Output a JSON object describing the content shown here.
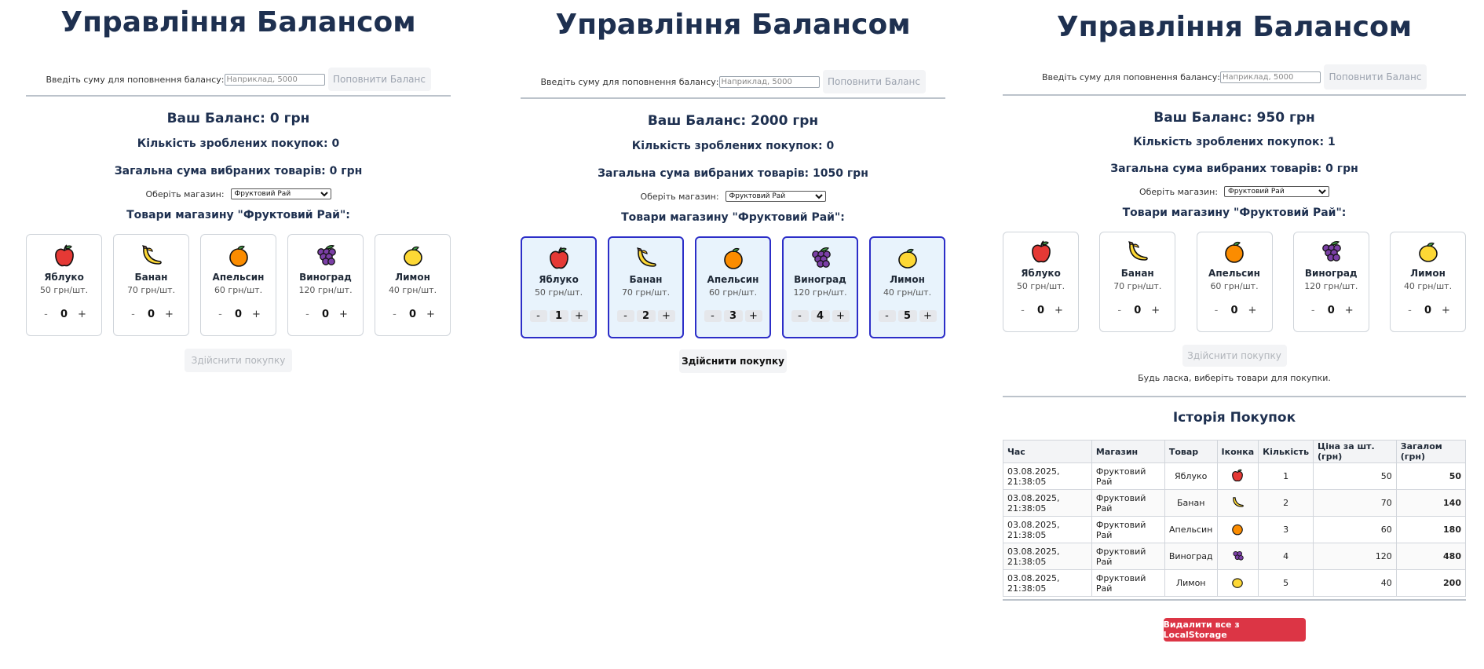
{
  "screens": [
    {
      "title": "Управління Балансом",
      "deposit": {
        "label": "Введіть суму для поповнення балансу:",
        "placeholder": "Наприклад, 5000",
        "button": "Поповнити Баланс"
      },
      "balance": "Ваш Баланс: 0 грн",
      "purchases_count": "Кількість зроблених покупок: 0",
      "selected_total": "Загальна сума вибраних товарів: 0 грн",
      "shop_label": "Оберіть магазин:",
      "shop_selected": "Фруктовий Рай",
      "goods_heading": "Товари магазину \"Фруктовий Рай\":",
      "products": [
        {
          "icon": "apple-icon",
          "name": "Яблуко",
          "price": "50 грн/шт.",
          "qty": "0"
        },
        {
          "icon": "banana-icon",
          "name": "Банан",
          "price": "70 грн/шт.",
          "qty": "0"
        },
        {
          "icon": "orange-icon",
          "name": "Апельсин",
          "price": "60 грн/шт.",
          "qty": "0"
        },
        {
          "icon": "grapes-icon",
          "name": "Виноград",
          "price": "120 грн/шт.",
          "qty": "0"
        },
        {
          "icon": "lemon-icon",
          "name": "Лимон",
          "price": "40 грн/шт.",
          "qty": "0"
        }
      ],
      "buy_button": "Здійснити покупку"
    },
    {
      "title": "Управління Балансом",
      "deposit": {
        "label": "Введіть суму для поповнення балансу:",
        "placeholder": "Наприклад, 5000",
        "button": "Поповнити Баланс"
      },
      "balance": "Ваш Баланс: 2000 грн",
      "purchases_count": "Кількість зроблених покупок: 0",
      "selected_total": "Загальна сума вибраних товарів: 1050 грн",
      "shop_label": "Оберіть магазин:",
      "shop_selected": "Фруктовий Рай",
      "goods_heading": "Товари магазину \"Фруктовий Рай\":",
      "products": [
        {
          "icon": "apple-icon",
          "name": "Яблуко",
          "price": "50 грн/шт.",
          "qty": "1"
        },
        {
          "icon": "banana-icon",
          "name": "Банан",
          "price": "70 грн/шт.",
          "qty": "2"
        },
        {
          "icon": "orange-icon",
          "name": "Апельсин",
          "price": "60 грн/шт.",
          "qty": "3"
        },
        {
          "icon": "grapes-icon",
          "name": "Виноград",
          "price": "120 грн/шт.",
          "qty": "4"
        },
        {
          "icon": "lemon-icon",
          "name": "Лимон",
          "price": "40 грн/шт.",
          "qty": "5"
        }
      ],
      "buy_button": "Здійснити покупку"
    },
    {
      "title": "Управління Балансом",
      "deposit": {
        "label": "Введіть суму для поповнення балансу:",
        "placeholder": "Наприклад, 5000",
        "button": "Поповнити Баланс"
      },
      "balance": "Ваш Баланс: 950 грн",
      "purchases_count": "Кількість зроблених покупок: 1",
      "selected_total": "Загальна сума вибраних товарів: 0 грн",
      "shop_label": "Оберіть магазин:",
      "shop_selected": "Фруктовий Рай",
      "goods_heading": "Товари магазину \"Фруктовий Рай\":",
      "products": [
        {
          "icon": "apple-icon",
          "name": "Яблуко",
          "price": "50 грн/шт.",
          "qty": "0"
        },
        {
          "icon": "banana-icon",
          "name": "Банан",
          "price": "70 грн/шт.",
          "qty": "0"
        },
        {
          "icon": "orange-icon",
          "name": "Апельсин",
          "price": "60 грн/шт.",
          "qty": "0"
        },
        {
          "icon": "grapes-icon",
          "name": "Виноград",
          "price": "120 грн/шт.",
          "qty": "0"
        },
        {
          "icon": "lemon-icon",
          "name": "Лимон",
          "price": "40 грн/шт.",
          "qty": "0"
        }
      ],
      "buy_button": "Здійснити покупку",
      "hint": "Будь ласка, виберіть товари для покупки.",
      "history": {
        "title": "Історія Покупок",
        "headers": [
          "Час",
          "Магазин",
          "Товар",
          "Іконка",
          "Кількість",
          "Ціна за шт. (грн)",
          "Загалом (грн)"
        ],
        "rows": [
          {
            "time": "03.08.2025, 21:38:05",
            "shop": "Фруктовий Рай",
            "item": "Яблуко",
            "icon": "apple-icon",
            "qty": "1",
            "price": "50",
            "total": "50"
          },
          {
            "time": "03.08.2025, 21:38:05",
            "shop": "Фруктовий Рай",
            "item": "Банан",
            "icon": "banana-icon",
            "qty": "2",
            "price": "70",
            "total": "140"
          },
          {
            "time": "03.08.2025, 21:38:05",
            "shop": "Фруктовий Рай",
            "item": "Апельсин",
            "icon": "orange-icon",
            "qty": "3",
            "price": "60",
            "total": "180"
          },
          {
            "time": "03.08.2025, 21:38:05",
            "shop": "Фруктовий Рай",
            "item": "Виноград",
            "icon": "grapes-icon",
            "qty": "4",
            "price": "120",
            "total": "480"
          },
          {
            "time": "03.08.2025, 21:38:05",
            "shop": "Фруктовий Рай",
            "item": "Лимон",
            "icon": "lemon-icon",
            "qty": "5",
            "price": "40",
            "total": "200"
          }
        ]
      },
      "clear_button": "Видалити все з LocalStorage"
    }
  ],
  "qty_minus": "-",
  "qty_plus": "+",
  "colors": {
    "title": "#1e3050",
    "selected_border": "#2c2ec8",
    "selected_bg": "#e8f3fc",
    "danger": "#dc3545"
  }
}
